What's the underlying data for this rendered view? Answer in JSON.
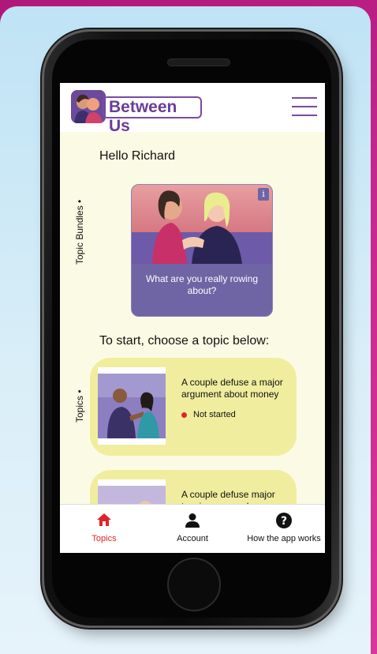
{
  "app": {
    "name": "Between Us",
    "greeting": "Hello Richard"
  },
  "header": {
    "menu_icon": "hamburger-menu-icon",
    "accent_color": "#7a4aa3"
  },
  "side_labels": {
    "bundles": "Topic Bundles •",
    "topics": "Topics •"
  },
  "bundle": {
    "caption": "What are you really rowing about?",
    "info_label": "i"
  },
  "topics_heading": "To start, choose a topic below:",
  "topics": [
    {
      "title": "A couple defuse a major argument about money",
      "status": "Not started",
      "status_color": "#e0232b"
    },
    {
      "title": "A couple defuse major tensions around"
    }
  ],
  "bottom_nav": [
    {
      "label": "Topics",
      "icon": "home-icon",
      "active": true,
      "color": "#e0232b"
    },
    {
      "label": "Account",
      "icon": "person-icon",
      "active": false
    },
    {
      "label": "How the app works",
      "icon": "help-icon",
      "active": false
    }
  ]
}
